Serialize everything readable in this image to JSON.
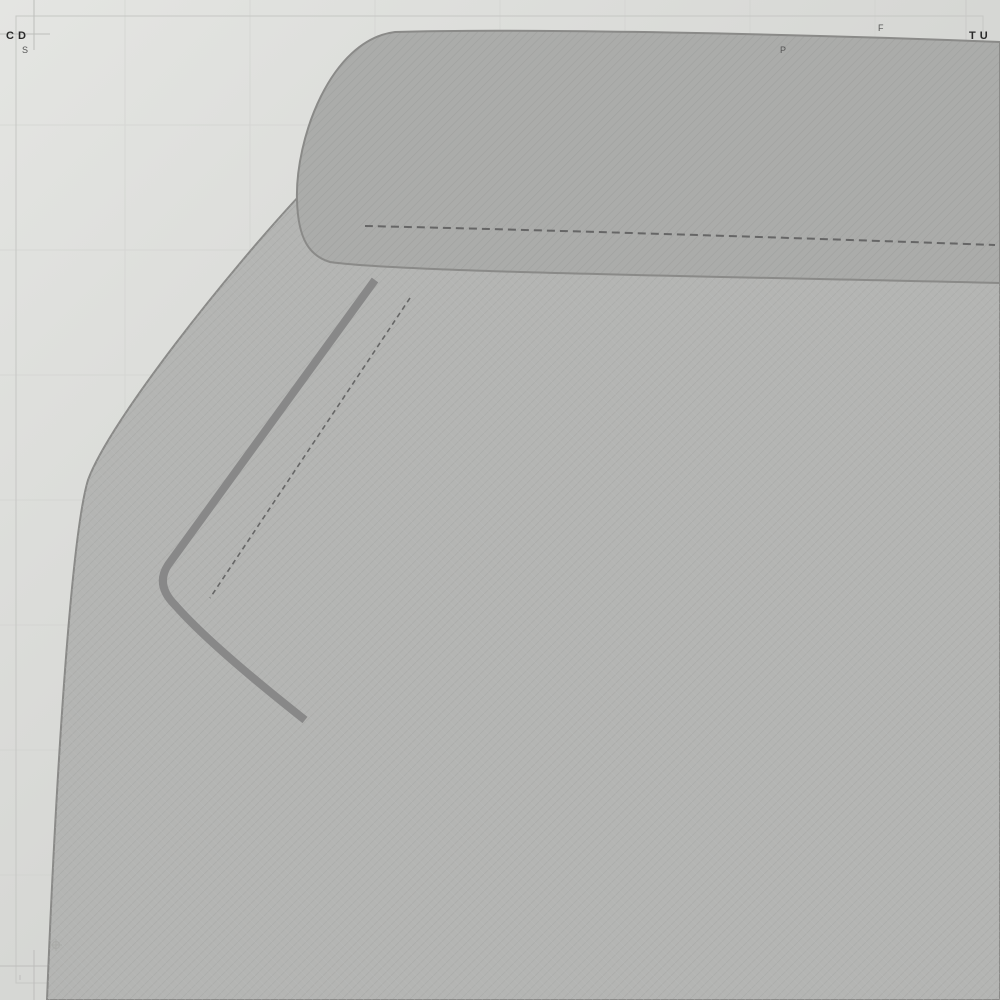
{
  "corner_labels": {
    "top_left_main": "C D",
    "top_left_sub": "S",
    "top_right_main": "T U",
    "top_center_sub": "P",
    "top_right_sub": "F"
  },
  "colors": {
    "background_light": "#e6e6e3",
    "background_dark": "#cfcfcd",
    "fabric": "#b4b5b3",
    "fabric_shadow": "#a9aaa8",
    "outline": "#8a8a88",
    "seam_stitch": "#666666",
    "sewn_seam": "#888888",
    "frame_line": "#c4c4c2"
  },
  "icons": {
    "registration_mark": "crosshair-icon"
  }
}
